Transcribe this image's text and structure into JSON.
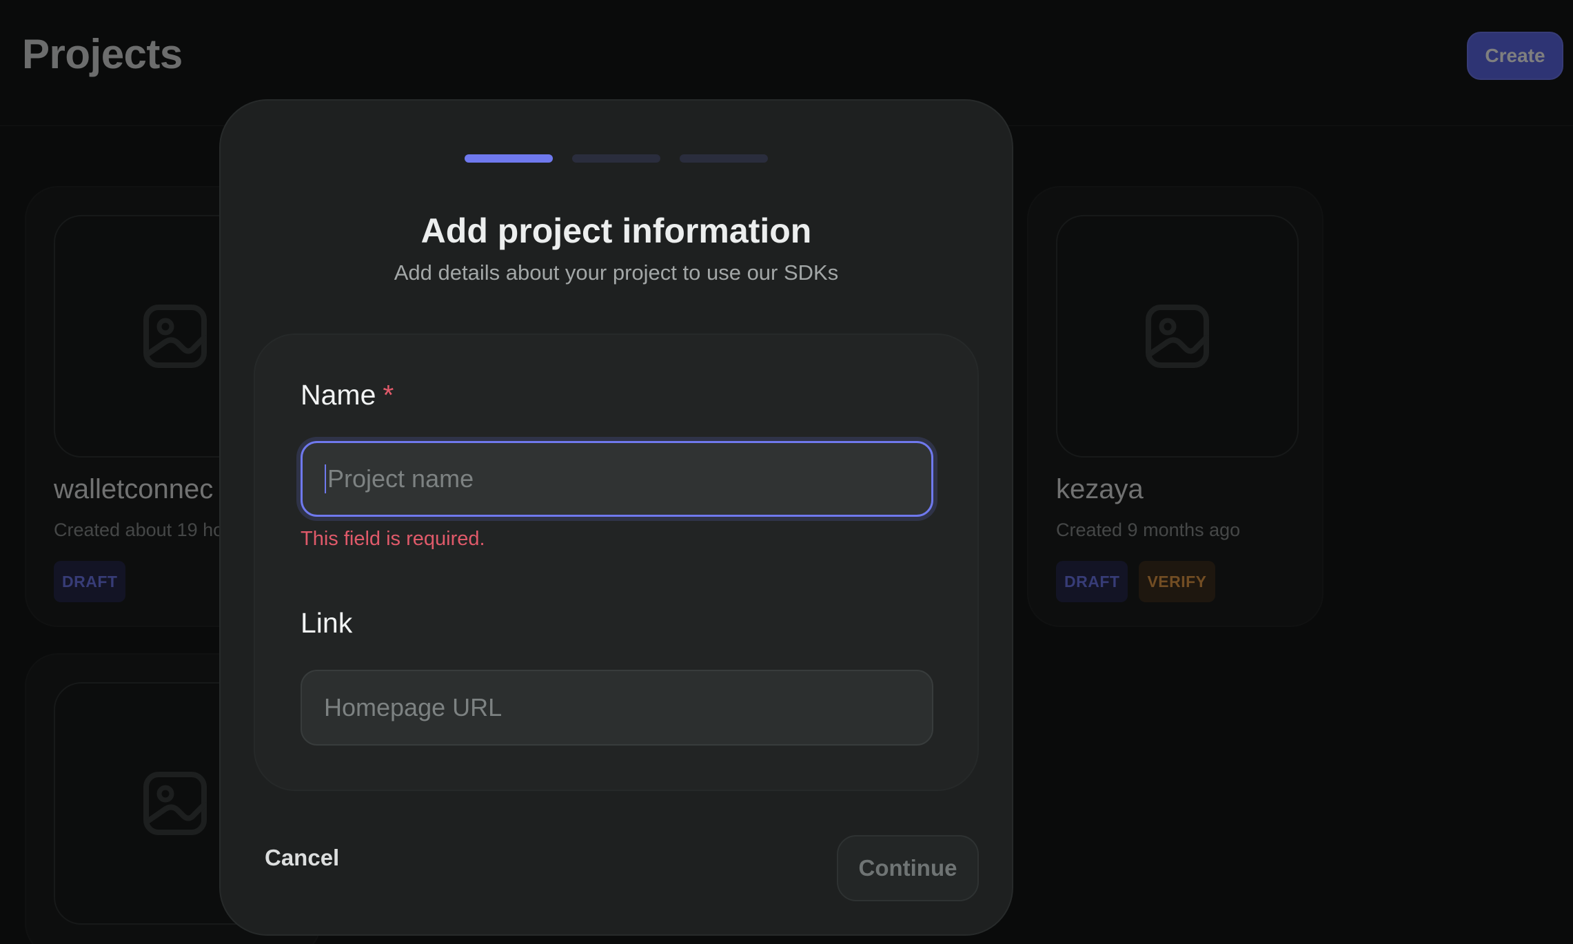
{
  "header": {
    "title": "Projects",
    "create_label": "Create"
  },
  "projects": [
    {
      "name": "walletconnec",
      "created": "Created about 19 ho",
      "badges": [
        "DRAFT"
      ]
    },
    {
      "name": "kezaya",
      "created": "Created 9 months ago",
      "badges": [
        "DRAFT",
        "VERIFY"
      ]
    },
    {
      "name": "",
      "created": "",
      "badges": []
    }
  ],
  "modal": {
    "step_count": 3,
    "active_step": 1,
    "title": "Add project information",
    "subtitle": "Add details about your project to use our SDKs",
    "name_label": "Name",
    "required_marker": "*",
    "name_placeholder": "Project name",
    "name_value": "",
    "name_error": "This field is required.",
    "link_label": "Link",
    "link_placeholder": "Homepage URL",
    "link_value": "",
    "cancel_label": "Cancel",
    "continue_label": "Continue"
  },
  "colors": {
    "accent": "#6f79ee",
    "error": "#e05a6a",
    "draft_badge": "#6f79ee",
    "verify_badge": "#e59a47"
  },
  "icons": {
    "project_thumbnail": "image-icon"
  }
}
